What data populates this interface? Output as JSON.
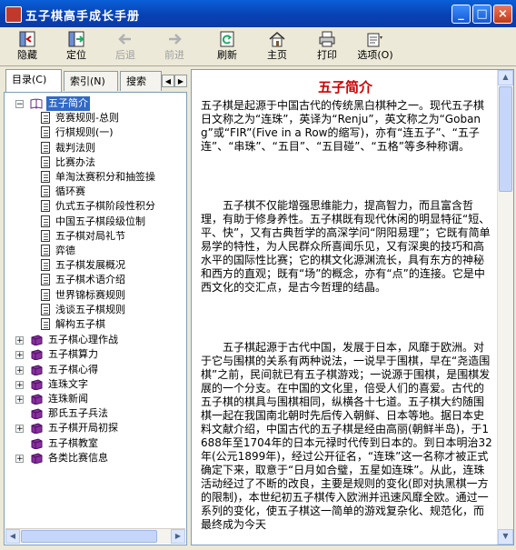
{
  "window": {
    "title": "五子棋高手成长手册",
    "minimize": "_",
    "maximize": "□",
    "close": "×"
  },
  "toolbar": {
    "hide": "隐藏",
    "locate": "定位",
    "back": "后退",
    "forward": "前进",
    "refresh": "刷新",
    "home": "主页",
    "print": "打印",
    "options": "选项(O)"
  },
  "tabs": {
    "contents": "目录(C)",
    "index": "索引(N)",
    "search": "搜索"
  },
  "tree": {
    "root": "五子简介",
    "children": [
      "竞赛规则-总则",
      "行棋规则(一)",
      "裁判法则",
      "比赛办法",
      "单淘汰赛积分和抽签操",
      "循环赛",
      "仇式五子棋阶段性积分",
      "中国五子棋段级位制",
      "五子棋对局礼节",
      "弈德",
      "五子棋发展概况",
      "五子棋术语介绍",
      "世界锦标赛规则",
      "浅谈五子棋规则",
      "解构五子棋"
    ],
    "groups": [
      {
        "label": "五子棋心理作战",
        "expandable": true
      },
      {
        "label": "五子棋算力",
        "expandable": true
      },
      {
        "label": "五子棋心得",
        "expandable": true
      },
      {
        "label": "连珠文字",
        "expandable": true
      },
      {
        "label": "连珠新闻",
        "expandable": true
      },
      {
        "label": "那氏五子兵法",
        "expandable": false
      },
      {
        "label": "五子棋开局初探",
        "expandable": true
      },
      {
        "label": "五子棋教室",
        "expandable": false
      },
      {
        "label": "各类比赛信息",
        "expandable": true
      }
    ]
  },
  "content": {
    "title": "五子简介",
    "paragraphs": [
      "五子棋是起源于中国古代的传统黑白棋种之一。现代五子棋日文称之为“连珠”，英译为“Renju”，英文称之为“Gobang”或“FIR”(Five in a Row的缩写)，亦有“连五子”、“五子连”、“串珠”、“五目”、“五目碰”、“五格”等多种称谓。",
      "五子棋不仅能增强思维能力，提高智力，而且富含哲理，有助于修身养性。五子棋既有现代休闲的明显特征“短、平、快”，又有古典哲学的高深学问“阴阳易理”；它既有简单易学的特性，为人民群众所喜闻乐见，又有深奥的技巧和高水平的国际性比赛；它的棋文化源渊流长，具有东方的神秘和西方的直观；既有“场”的概念，亦有“点”的连接。它是中西文化的交汇点，是古今哲理的结晶。",
      "五子棋起源于古代中国，发展于日本，风靡于欧洲。对于它与围棋的关系有两种说法，一说早于围棋，早在“尧造围棋”之前，民间就已有五子棋游戏；一说源于围棋，是围棋发展的一个分支。在中国的文化里，倍受人们的喜爱。古代的五子棋的棋具与围棋相同，纵横各十七道。五子棋大约随围棋一起在我国南北朝时先后传入朝鲜、日本等地。据日本史料文献介绍，中国古代的五子棋是经由高丽(朝鲜半岛)，于1688年至1704年的日本元禄时代传到日本的。到日本明治32年(公元1899年)，经过公开征名，“连珠”这一名称才被正式确定下来，取意于“日月如合璧，五星如连珠”。从此，连珠活动经过了不断的改良，主要是规则的变化(即对执黑棋一方的限制)，本世纪初五子棋传入欧洲并迅速风靡全欧。通过一系列的变化，使五子棋这一简单的游戏复杂化、规范化，而最终成为今天"
    ]
  }
}
